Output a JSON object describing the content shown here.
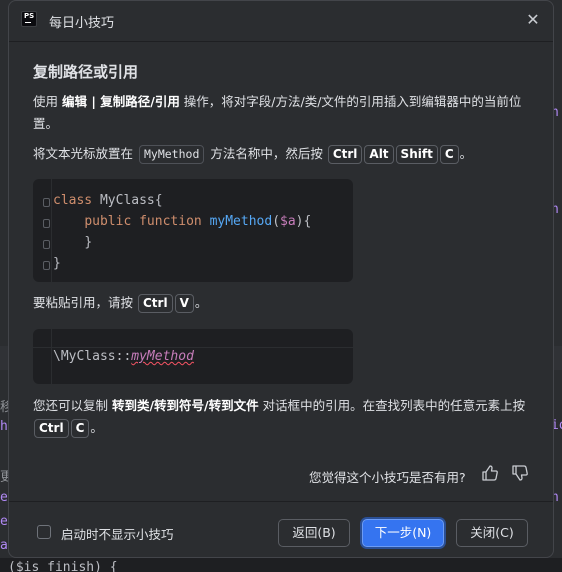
{
  "background": {
    "right_chars": [
      "h",
      "h",
      "io",
      "h"
    ],
    "left_chars": [
      "移",
      "h",
      "更",
      "e",
      "e",
      "a"
    ],
    "bottom_code": "($is_finish) {"
  },
  "dialog": {
    "title": "每日小技巧",
    "app_icon_text": "PS",
    "close_icon": "close-icon",
    "heading": "复制路径或引用",
    "p1": {
      "prefix": "使用 ",
      "menu_path": "编辑 | 复制路径/引用",
      "suffix": " 操作，将对字段/方法/类/文件的引用插入到编辑器中的当前位置。"
    },
    "p2": {
      "prefix": "将文本光标放置在 ",
      "chip": "MyMethod",
      "middle": " 方法名称中，然后按 ",
      "keys": [
        "Ctrl",
        "Alt",
        "Shift",
        "C"
      ],
      "suffix": "。"
    },
    "code1": {
      "line1_kw": "class",
      "line1_rest": " MyClass{",
      "line2_kw1": "public",
      "line2_kw2": "function",
      "line2_fn": "myMethod",
      "line2_open": "(",
      "line2_var": "$a",
      "line2_close": "){",
      "line3": "}",
      "line4": "}"
    },
    "p3": {
      "prefix": "要粘贴引用，请按 ",
      "keys": [
        "Ctrl",
        "V"
      ],
      "suffix": "。"
    },
    "code2": {
      "prefix": "\\MyClass::",
      "method": "myMethod"
    },
    "p4": {
      "prefix": "您还可以复制 ",
      "bold": "转到类/转到符号/转到文件",
      "middle": " 对话框中的引用。在查找列表中的任意元素上按 ",
      "keys": [
        "Ctrl",
        "C"
      ],
      "suffix": "。"
    },
    "feedback": {
      "question": "您觉得这个小技巧是否有用?",
      "up_icon": "thumbs-up-icon",
      "down_icon": "thumbs-down-icon"
    },
    "footer": {
      "checkbox_label": "启动时不显示小技巧",
      "checkbox_checked": false,
      "back_label": "返回(B)",
      "next_label": "下一步(N)",
      "close_label": "关闭(C)"
    },
    "colors": {
      "accent": "#3574f0",
      "keyword": "#cf8e6d",
      "function": "#56a8f5",
      "variable": "#c77dbb"
    }
  }
}
